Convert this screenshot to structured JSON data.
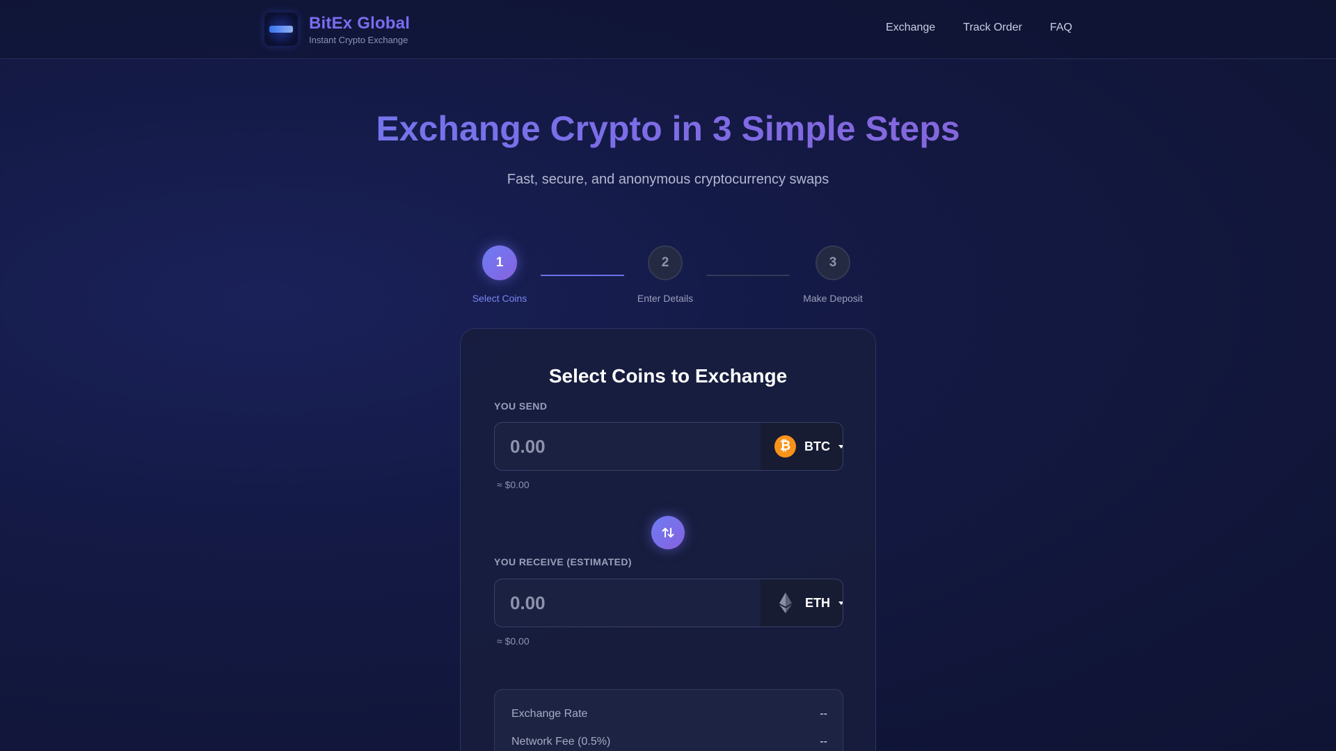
{
  "header": {
    "brand_name": "BitEx Global",
    "brand_tagline": "Instant Crypto Exchange",
    "nav": [
      "Exchange",
      "Track Order",
      "FAQ"
    ]
  },
  "hero": {
    "title": "Exchange Crypto in 3 Simple Steps",
    "subtitle": "Fast, secure, and anonymous cryptocurrency swaps"
  },
  "steps": [
    {
      "number": "1",
      "label": "Select Coins",
      "state": "active"
    },
    {
      "number": "2",
      "label": "Enter Details",
      "state": "idle"
    },
    {
      "number": "3",
      "label": "Make Deposit",
      "state": "idle"
    }
  ],
  "card": {
    "title": "Select Coins to Exchange",
    "send": {
      "label": "YOU SEND",
      "placeholder": "0.00",
      "coin": "BTC",
      "coin_icon": "bitcoin-icon",
      "usd": "≈ $0.00"
    },
    "receive": {
      "label": "YOU RECEIVE (ESTIMATED)",
      "placeholder": "0.00",
      "coin": "ETH",
      "coin_icon": "ethereum-icon",
      "usd": "≈ $0.00"
    },
    "summary": [
      {
        "label": "Exchange Rate",
        "value": "--"
      },
      {
        "label": "Network Fee (0.5%)",
        "value": "--"
      }
    ]
  },
  "colors": {
    "accent": "#7b6df0",
    "btc": "#f7931a"
  }
}
